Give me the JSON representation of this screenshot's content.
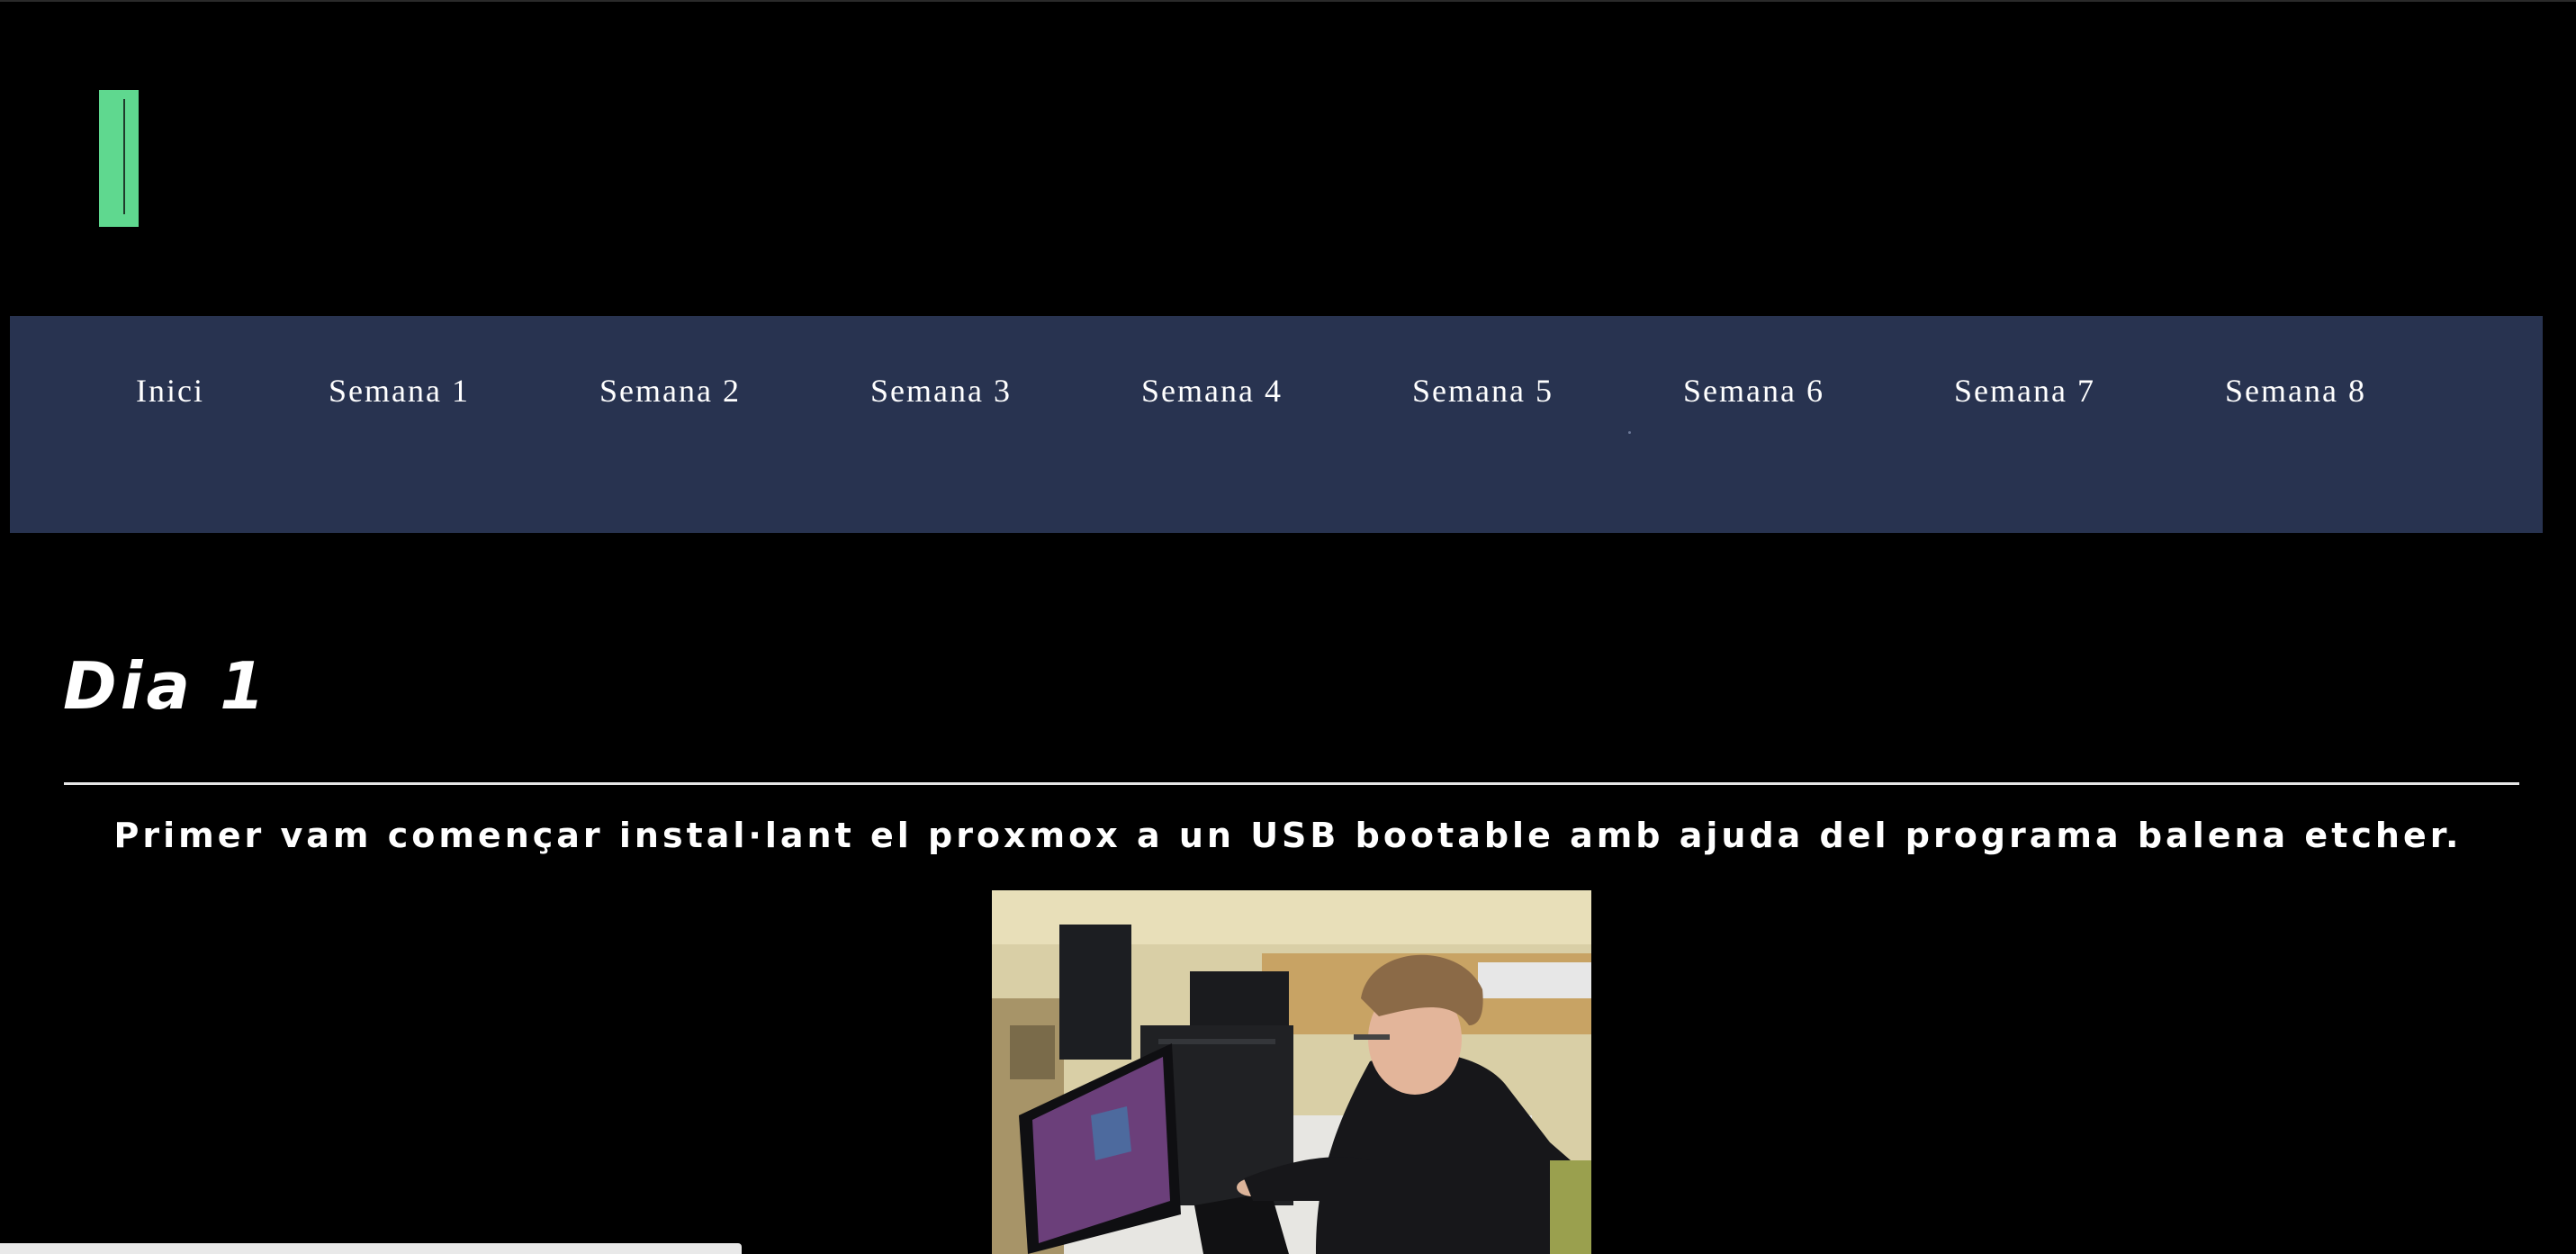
{
  "nav": {
    "items": [
      {
        "label": "Inici"
      },
      {
        "label": "Semana 1"
      },
      {
        "label": "Semana 2"
      },
      {
        "label": "Semana 3"
      },
      {
        "label": "Semana 4"
      },
      {
        "label": "Semana 5"
      },
      {
        "label": "Semana 6"
      },
      {
        "label": "Semana 7"
      },
      {
        "label": "Semana 8"
      }
    ]
  },
  "main": {
    "title": "Dia 1",
    "paragraph": "Primer vam començar instal·lant el proxmox a un USB bootable amb ajuda del programa balena etcher."
  },
  "colors": {
    "background": "#000000",
    "navbar": "#283350",
    "logo": "#5fd88f",
    "text": "#ffffff"
  }
}
